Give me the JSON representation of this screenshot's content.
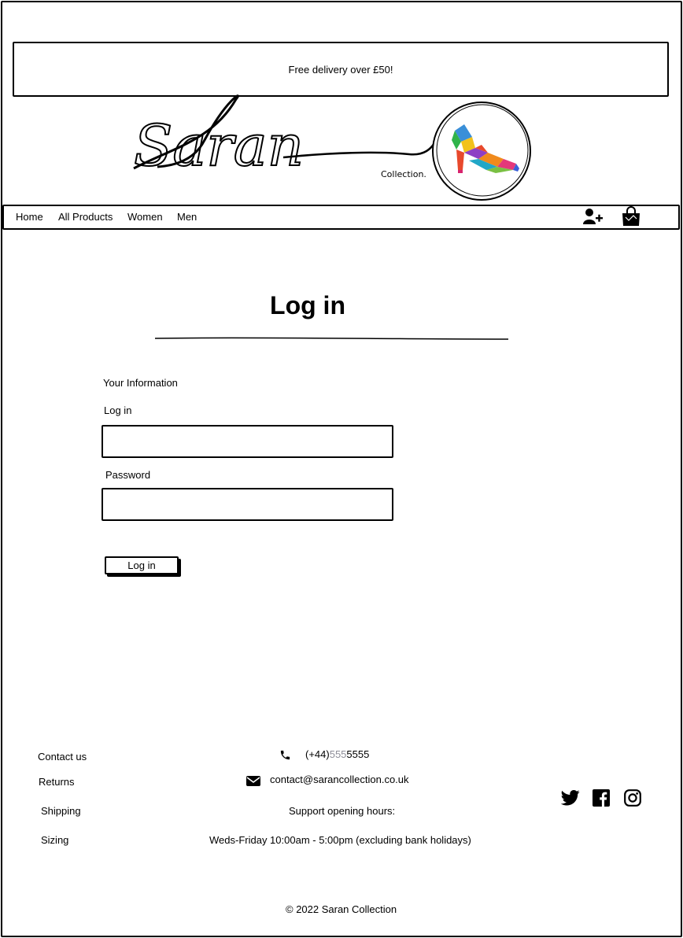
{
  "banner": {
    "text": "Free delivery over £50!"
  },
  "logo": {
    "script_text": "Saran",
    "sub_text": "Collection."
  },
  "nav": {
    "items": [
      "Home",
      "All Products",
      "Women",
      "Men"
    ],
    "icons": [
      "add-user-icon",
      "shopping-bag-icon"
    ]
  },
  "page": {
    "title": "Log in"
  },
  "form": {
    "section_label": "Your Information",
    "login_label": "Log in",
    "login_value": "",
    "password_label": "Password",
    "password_value": "",
    "submit_label": "Log in"
  },
  "footer": {
    "links": [
      "Contact us",
      "Returns",
      "Shipping",
      "Sizing"
    ],
    "phone": {
      "prefix": "(+44)",
      "middle": "555",
      "suffix": "5555"
    },
    "email": "contact@sarancollection.co.uk",
    "support_heading": "Support opening hours:",
    "support_hours": "Weds-Friday 10:00am - 5:00pm (excluding bank holidays)",
    "social_icons": [
      "twitter-icon",
      "facebook-icon",
      "instagram-icon"
    ],
    "copyright": "© 2022 Saran Collection"
  },
  "colors": {
    "text": "#000000",
    "muted": "#8e8e99",
    "background": "#ffffff"
  }
}
